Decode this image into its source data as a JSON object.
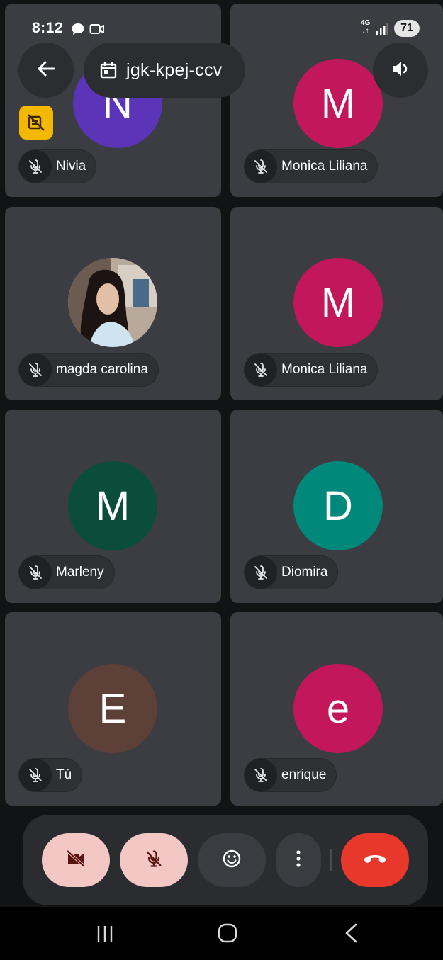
{
  "status": {
    "time": "8:12",
    "network": "4G",
    "battery": "71"
  },
  "meeting": {
    "code": "jgk-kpej-ccv"
  },
  "tiles": [
    {
      "name": "Nivia",
      "initial": "N",
      "color": "#5b34b8"
    },
    {
      "name": "Monica Liliana",
      "initial": "M",
      "color": "#c2185b"
    },
    {
      "name": "magda carolina",
      "initial": "",
      "color": "#8a7a70",
      "photo": true
    },
    {
      "name": "Monica Liliana",
      "initial": "M",
      "color": "#c2185b"
    },
    {
      "name": "Marleny",
      "initial": "M",
      "color": "#0b4d3b"
    },
    {
      "name": "Diomira",
      "initial": "D",
      "color": "#00897b"
    },
    {
      "name": "Tú",
      "initial": "E",
      "color": "#5d4037"
    },
    {
      "name": "enrique",
      "initial": "e",
      "color": "#c2185b"
    }
  ],
  "icons": {
    "back": "arrow-left-icon",
    "calendar": "calendar-icon",
    "speaker": "speaker-icon",
    "mic_off": "mic-off-icon",
    "camera_off": "camera-off-icon",
    "emoji": "emoji-icon",
    "more": "more-vert-icon",
    "hangup": "hang-up-icon",
    "host": "host-controls-icon"
  },
  "colors": {
    "muted_control_bg": "#f3c7c4",
    "hangup_bg": "#e8382b",
    "host_badge": "#f5b800"
  }
}
